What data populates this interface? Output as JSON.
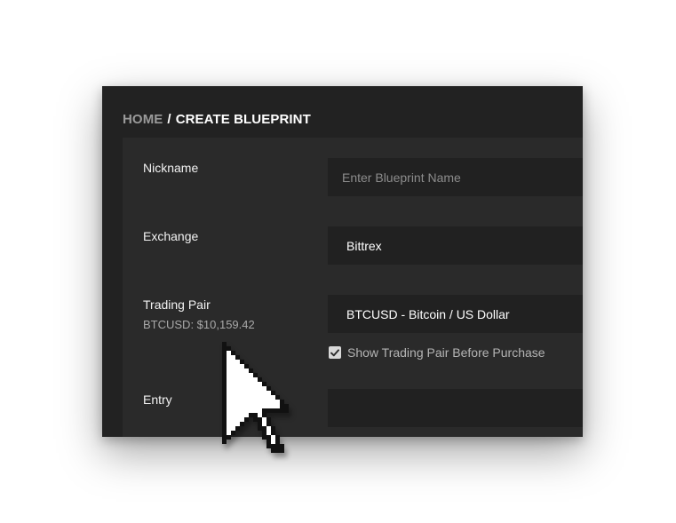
{
  "breadcrumb": {
    "home": "HOME",
    "separator": "/",
    "current": "CREATE BLUEPRINT"
  },
  "form": {
    "nickname": {
      "label": "Nickname",
      "placeholder": "Enter Blueprint Name",
      "value": ""
    },
    "exchange": {
      "label": "Exchange",
      "value": "Bittrex"
    },
    "trading_pair": {
      "label": "Trading Pair",
      "price": "BTCUSD: $10,159.42",
      "value": "BTCUSD - Bitcoin / US Dollar",
      "show_checkbox_label": "Show Trading Pair Before Purchase",
      "show_checkbox_checked": true
    },
    "entry": {
      "label": "Entry",
      "value": ""
    }
  },
  "colors": {
    "window_bg": "#222222",
    "panel_bg": "#2a2a2a",
    "field_bg": "#212121",
    "text_primary": "#f2f2f2",
    "text_muted": "#9a9a9a"
  },
  "icons": {
    "cursor": "mouse-pointer-icon",
    "checkbox": "checkmark-icon"
  }
}
